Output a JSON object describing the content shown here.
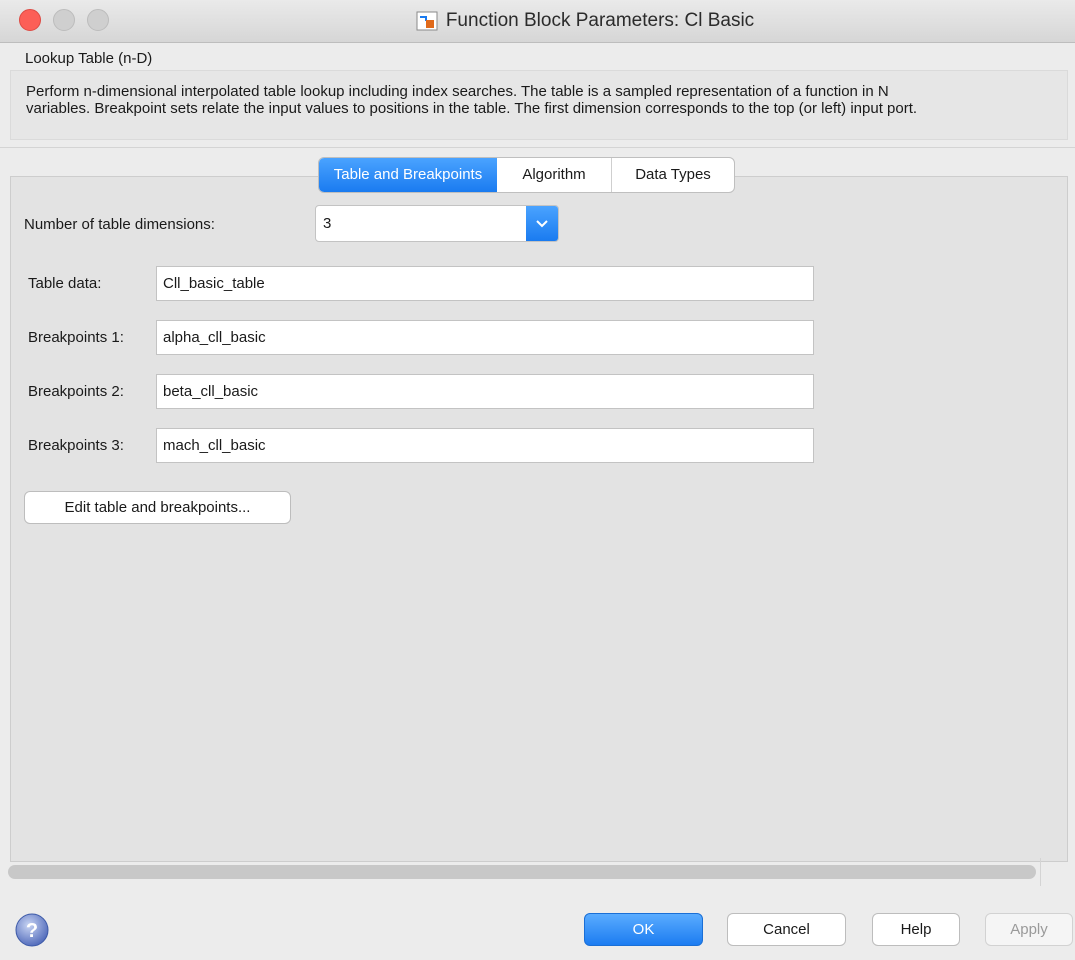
{
  "window": {
    "title": "Function Block Parameters: Cl Basic"
  },
  "block": {
    "type": "Lookup Table (n-D)",
    "description_lines": [
      "Perform n-dimensional interpolated table lookup including index searches. The table is a sampled representation of a function in N",
      "variables. Breakpoint sets relate the input values to positions in the table. The first dimension corresponds to the top (or left) input port."
    ]
  },
  "tabs": [
    {
      "label": "Table and Breakpoints",
      "active": true
    },
    {
      "label": "Algorithm",
      "active": false
    },
    {
      "label": "Data Types",
      "active": false
    }
  ],
  "params": {
    "dimensions_label": "Number of table dimensions:",
    "dimensions_value": "3",
    "table_data_label": "Table data:",
    "table_data_value": "Cll_basic_table",
    "bp1_label": "Breakpoints 1:",
    "bp1_value": "alpha_cll_basic",
    "bp2_label": "Breakpoints 2:",
    "bp2_value": "beta_cll_basic",
    "bp3_label": "Breakpoints 3:",
    "bp3_value": "mach_cll_basic",
    "edit_button": "Edit table and breakpoints..."
  },
  "footer": {
    "ok": "OK",
    "cancel": "Cancel",
    "help": "Help",
    "apply": "Apply",
    "help_icon": "question-mark-icon"
  },
  "colors": {
    "accent": "#1a7bf0",
    "close": "#fc5f57"
  }
}
